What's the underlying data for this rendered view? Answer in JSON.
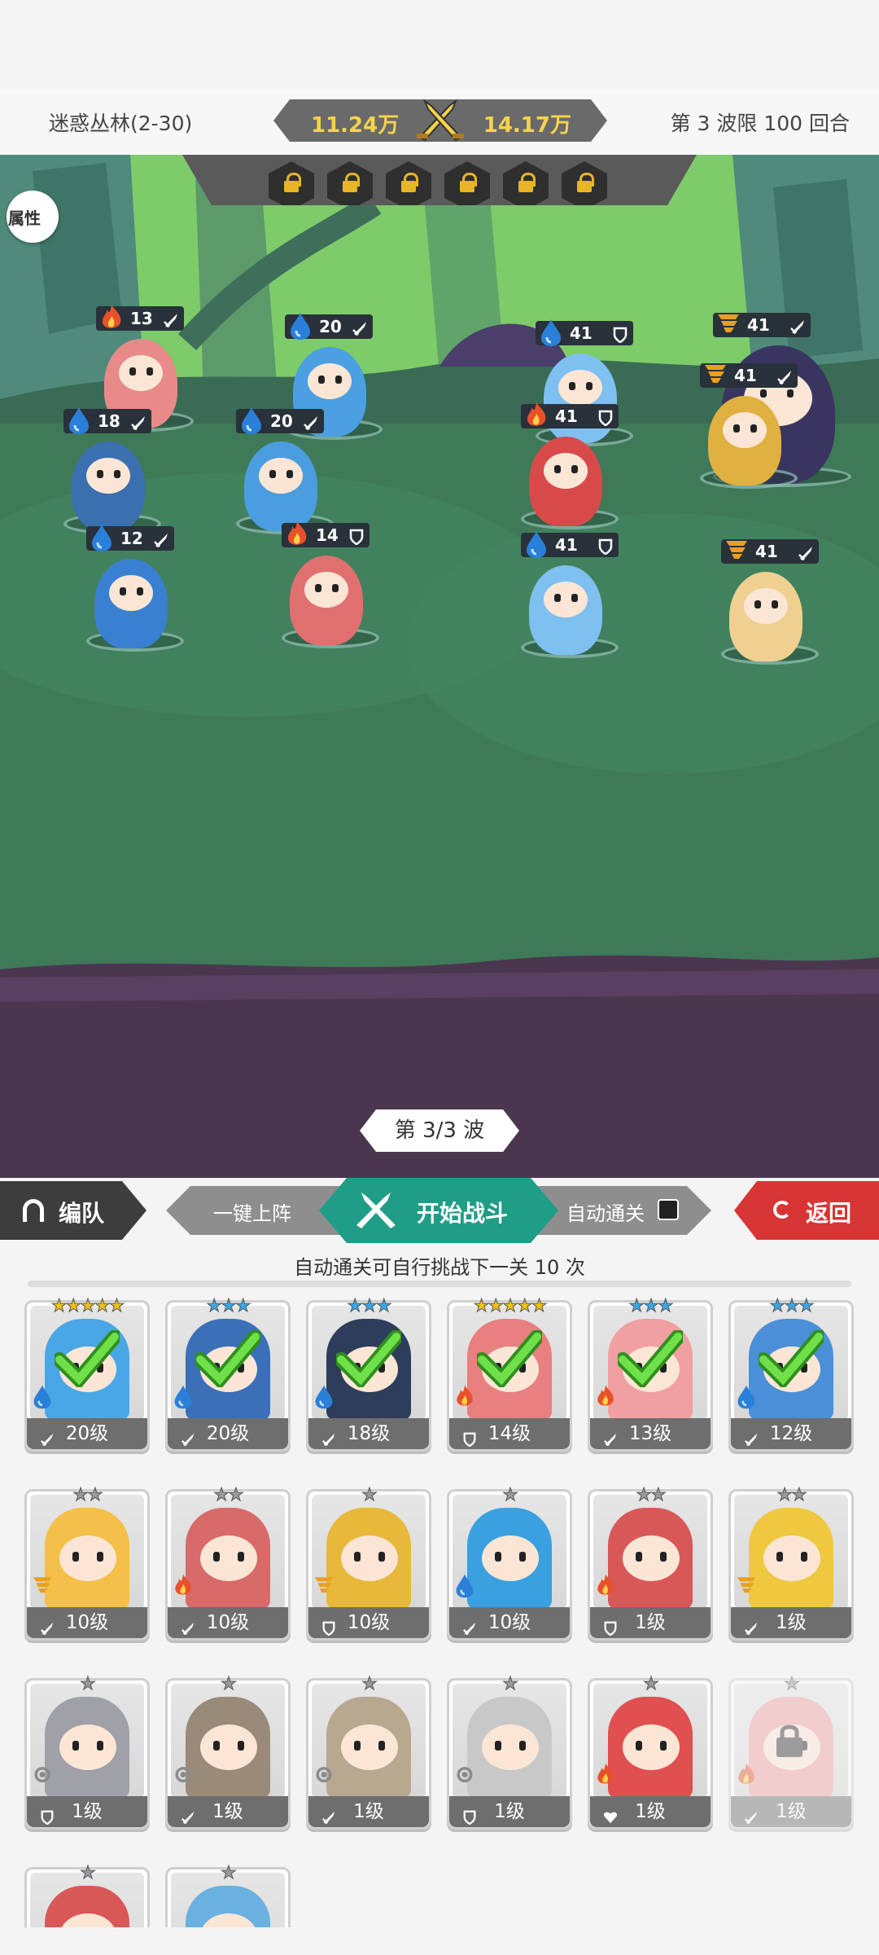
{
  "header": {
    "stage_name": "迷惑丛林(2-30)",
    "wave_limit": "第 3 波限 100 回合",
    "my_power": "11.24万",
    "enemy_power": "14.17万"
  },
  "battle": {
    "attr_button": "属性",
    "locked_slots": 6,
    "wave_label": "第 3/3 波",
    "allies": [
      {
        "level": "13",
        "element": "fire",
        "role": "sword"
      },
      {
        "level": "20",
        "element": "water",
        "role": "sword"
      },
      {
        "level": "18",
        "element": "water",
        "role": "sword"
      },
      {
        "level": "20",
        "element": "water",
        "role": "sword"
      },
      {
        "level": "12",
        "element": "water",
        "role": "sword"
      },
      {
        "level": "14",
        "element": "fire",
        "role": "shield"
      }
    ],
    "enemies": [
      {
        "level": "41",
        "element": "water",
        "role": "shield"
      },
      {
        "level": "41",
        "element": "wind",
        "role": "sword"
      },
      {
        "level": "41",
        "element": "fire",
        "role": "shield"
      },
      {
        "level": "41",
        "element": "wind",
        "role": "sword"
      },
      {
        "level": "41",
        "element": "water",
        "role": "shield"
      },
      {
        "level": "41",
        "element": "wind",
        "role": "sword"
      }
    ]
  },
  "actions": {
    "team": "编队",
    "quick_deploy": "一键上阵",
    "start_battle": "开始战斗",
    "auto_clear": "自动通关",
    "back": "返回",
    "auto_hint": "自动通关可自行挑战下一关 10 次"
  },
  "roster": [
    {
      "level": "20级",
      "stars": "★★★★★",
      "star_color": "#f2c21b",
      "element": "water",
      "role": "sword",
      "selected": true,
      "color": "#4aa7e6"
    },
    {
      "level": "20级",
      "stars": "★★★",
      "star_color": "#3aa8e8",
      "element": "water",
      "role": "sword",
      "selected": true,
      "color": "#3b6fb8"
    },
    {
      "level": "18级",
      "stars": "★★★",
      "star_color": "#3aa8e8",
      "element": "water",
      "role": "sword",
      "selected": true,
      "color": "#2d3d5a"
    },
    {
      "level": "14级",
      "stars": "★★★★★",
      "star_color": "#f2c21b",
      "element": "fire",
      "role": "shield",
      "selected": true,
      "color": "#e88080"
    },
    {
      "level": "13级",
      "stars": "★★★",
      "star_color": "#3aa8e8",
      "element": "fire",
      "role": "sword",
      "selected": true,
      "color": "#f0a0a0"
    },
    {
      "level": "12级",
      "stars": "★★★",
      "star_color": "#3aa8e8",
      "element": "water",
      "role": "sword",
      "selected": true,
      "color": "#4a8fd8"
    },
    {
      "level": "10级",
      "stars": "★★",
      "star_color": "#9a9a9a",
      "element": "wind",
      "role": "sword",
      "selected": false,
      "color": "#f4c04a"
    },
    {
      "level": "10级",
      "stars": "★★",
      "star_color": "#9a9a9a",
      "element": "fire",
      "role": "sword",
      "selected": false,
      "color": "#d86a6a"
    },
    {
      "level": "10级",
      "stars": "★",
      "star_color": "#9a9a9a",
      "element": "wind",
      "role": "shield",
      "selected": false,
      "color": "#e8b83a"
    },
    {
      "level": "10级",
      "stars": "★",
      "star_color": "#9a9a9a",
      "element": "water",
      "role": "sword",
      "selected": false,
      "color": "#3aa0e0"
    },
    {
      "level": "1级",
      "stars": "★★",
      "star_color": "#9a9a9a",
      "element": "fire",
      "role": "shield",
      "selected": false,
      "color": "#d85858"
    },
    {
      "level": "1级",
      "stars": "★★",
      "star_color": "#9a9a9a",
      "element": "wind",
      "role": "sword",
      "selected": false,
      "color": "#f0c840"
    },
    {
      "level": "1级",
      "stars": "★",
      "star_color": "#9a9a9a",
      "element": "light",
      "role": "shield",
      "selected": false,
      "color": "#a0a0a8"
    },
    {
      "level": "1级",
      "stars": "★",
      "star_color": "#9a9a9a",
      "element": "light",
      "role": "sword",
      "selected": false,
      "color": "#9a8a7a"
    },
    {
      "level": "1级",
      "stars": "★",
      "star_color": "#9a9a9a",
      "element": "light",
      "role": "sword",
      "selected": false,
      "color": "#b8a890"
    },
    {
      "level": "1级",
      "stars": "★",
      "star_color": "#9a9a9a",
      "element": "light",
      "role": "shield",
      "selected": false,
      "color": "#c8c8c8"
    },
    {
      "level": "1级",
      "stars": "★",
      "star_color": "#9a9a9a",
      "element": "fire",
      "role": "heart",
      "selected": false,
      "color": "#e05050"
    },
    {
      "level": "1级",
      "stars": "★",
      "star_color": "#9a9a9a",
      "element": "fire",
      "role": "sword",
      "selected": false,
      "locked": true,
      "color": "#f0a0a0"
    },
    {
      "level": "",
      "stars": "★",
      "star_color": "#9a9a9a",
      "element": "fire",
      "role": "sword",
      "selected": false,
      "color": "#d85858"
    },
    {
      "level": "",
      "stars": "★",
      "star_color": "#9a9a9a",
      "element": "water",
      "role": "sword",
      "selected": false,
      "color": "#6ab0e0"
    }
  ],
  "colors": {
    "fire": "#e8502a",
    "water": "#2a7fd8",
    "wind": "#e8a020",
    "light": "#8a8a8a",
    "accent": "#1f9d87",
    "back": "#d83535"
  }
}
